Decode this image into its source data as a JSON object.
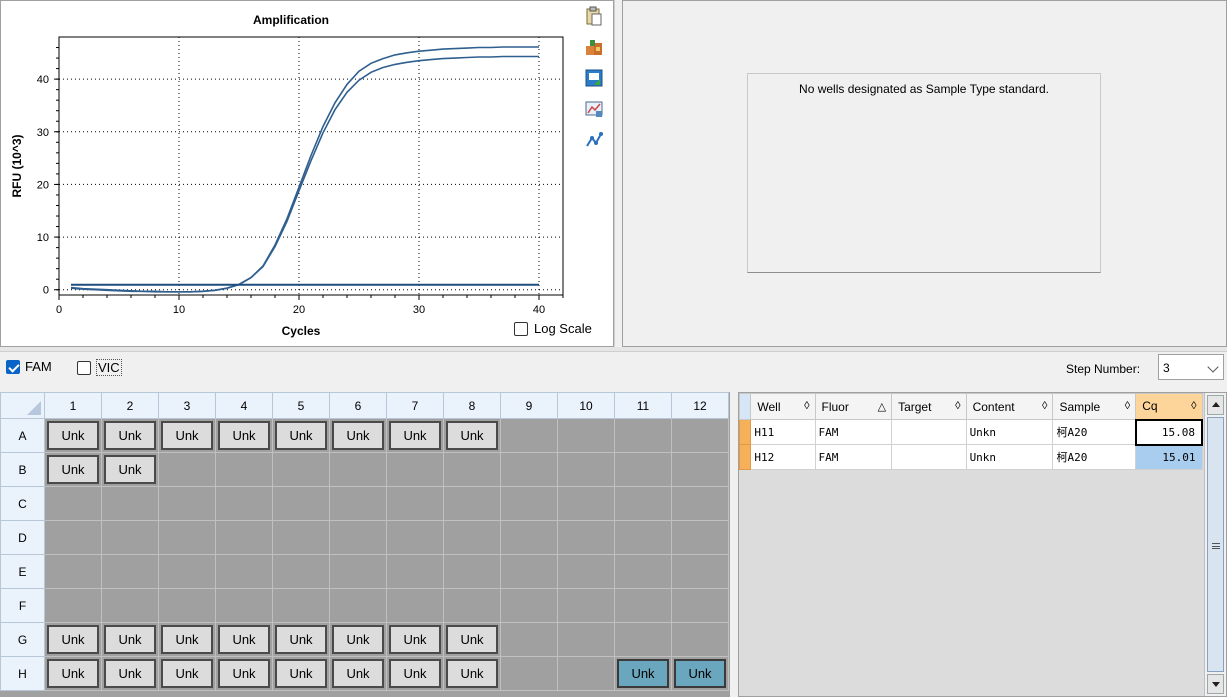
{
  "chart_data": {
    "type": "line",
    "title": "Amplification",
    "xlabel": "Cycles",
    "ylabel": "RFU (10^3)",
    "xlim": [
      0,
      42
    ],
    "ylim": [
      -1,
      48
    ],
    "xticks": [
      0,
      10,
      20,
      30,
      40
    ],
    "yticks": [
      0,
      10,
      20,
      30,
      40
    ],
    "grid": true,
    "series": [
      {
        "color": "#2f5f8f",
        "x": [
          1,
          2,
          3,
          4,
          5,
          6,
          7,
          8,
          9,
          10,
          11,
          12,
          13,
          14,
          15,
          16,
          17,
          18,
          19,
          20,
          21,
          22,
          23,
          24,
          25,
          26,
          27,
          28,
          29,
          30,
          31,
          32,
          33,
          34,
          35,
          36,
          37,
          38,
          39,
          40
        ],
        "y": [
          0.4,
          0.2,
          0.1,
          0.0,
          -0.1,
          -0.2,
          -0.3,
          -0.3,
          -0.4,
          -0.4,
          -0.4,
          -0.3,
          -0.1,
          0.3,
          1.0,
          2.3,
          4.5,
          8.5,
          13.5,
          19.5,
          25.5,
          31.0,
          35.5,
          39.0,
          41.5,
          43.0,
          43.9,
          44.6,
          45.0,
          45.3,
          45.5,
          45.7,
          45.8,
          45.9,
          46.0,
          46.0,
          46.1,
          46.1,
          46.1,
          46.1
        ]
      },
      {
        "color": "#2f5f8f",
        "x": [
          1,
          2,
          3,
          4,
          5,
          6,
          7,
          8,
          9,
          10,
          11,
          12,
          13,
          14,
          15,
          16,
          17,
          18,
          19,
          20,
          21,
          22,
          23,
          24,
          25,
          26,
          27,
          28,
          29,
          30,
          31,
          32,
          33,
          34,
          35,
          36,
          37,
          38,
          39,
          40
        ],
        "y": [
          0.3,
          0.1,
          0.0,
          -0.1,
          -0.2,
          -0.3,
          -0.3,
          -0.4,
          -0.4,
          -0.4,
          -0.4,
          -0.3,
          -0.1,
          0.3,
          1.0,
          2.3,
          4.4,
          8.2,
          13.0,
          18.8,
          24.5,
          29.8,
          34.2,
          37.5,
          39.8,
          41.3,
          42.2,
          42.8,
          43.2,
          43.5,
          43.7,
          43.9,
          44.0,
          44.1,
          44.2,
          44.2,
          44.3,
          44.3,
          44.3,
          44.3
        ]
      },
      {
        "color": "#1f4f7f",
        "x": [
          1,
          40
        ],
        "y": [
          1.0,
          1.0
        ]
      },
      {
        "color": "#1f4f7f",
        "x": [
          1,
          40
        ],
        "y": [
          0.9,
          0.9
        ]
      }
    ]
  },
  "chart": {
    "log_scale_label": "Log Scale",
    "log_scale_checked": false
  },
  "tools": [
    "copy-icon",
    "export-icon",
    "save-image-icon",
    "chart-settings-icon",
    "trace-icon"
  ],
  "standard_panel": {
    "message": "No wells designated as Sample Type standard."
  },
  "fluors": [
    {
      "label": "FAM",
      "checked": true
    },
    {
      "label": "VIC",
      "checked": false
    }
  ],
  "step": {
    "label": "Step Number:",
    "value": "3"
  },
  "plate": {
    "columns": [
      "1",
      "2",
      "3",
      "4",
      "5",
      "6",
      "7",
      "8",
      "9",
      "10",
      "11",
      "12"
    ],
    "rows": [
      "A",
      "B",
      "C",
      "D",
      "E",
      "F",
      "G",
      "H"
    ],
    "wells": {
      "A": [
        "Unk",
        "Unk",
        "Unk",
        "Unk",
        "Unk",
        "Unk",
        "Unk",
        "Unk",
        "",
        "",
        "",
        ""
      ],
      "B": [
        "Unk",
        "Unk",
        "",
        "",
        "",
        "",
        "",
        "",
        "",
        "",
        "",
        ""
      ],
      "C": [
        "",
        "",
        "",
        "",
        "",
        "",
        "",
        "",
        "",
        "",
        "",
        ""
      ],
      "D": [
        "",
        "",
        "",
        "",
        "",
        "",
        "",
        "",
        "",
        "",
        "",
        ""
      ],
      "E": [
        "",
        "",
        "",
        "",
        "",
        "",
        "",
        "",
        "",
        "",
        "",
        ""
      ],
      "F": [
        "",
        "",
        "",
        "",
        "",
        "",
        "",
        "",
        "",
        "",
        "",
        ""
      ],
      "G": [
        "Unk",
        "Unk",
        "Unk",
        "Unk",
        "Unk",
        "Unk",
        "Unk",
        "Unk",
        "",
        "",
        "",
        ""
      ],
      "H": [
        "Unk",
        "Unk",
        "Unk",
        "Unk",
        "Unk",
        "Unk",
        "Unk",
        "Unk",
        "",
        "",
        "Unk",
        "Unk"
      ]
    },
    "selected": [
      "H11",
      "H12"
    ]
  },
  "results": {
    "headers": [
      "Well",
      "Fluor",
      "Target",
      "Content",
      "Sample",
      "Cq"
    ],
    "sort_marks": [
      "◊",
      "△",
      "◊",
      "◊",
      "◊",
      "◊"
    ],
    "rows": [
      [
        "H11",
        "FAM",
        "",
        "Unkn",
        "柯A20",
        "15.08"
      ],
      [
        "H12",
        "FAM",
        "",
        "Unkn",
        "柯A20",
        "15.01"
      ]
    ]
  }
}
